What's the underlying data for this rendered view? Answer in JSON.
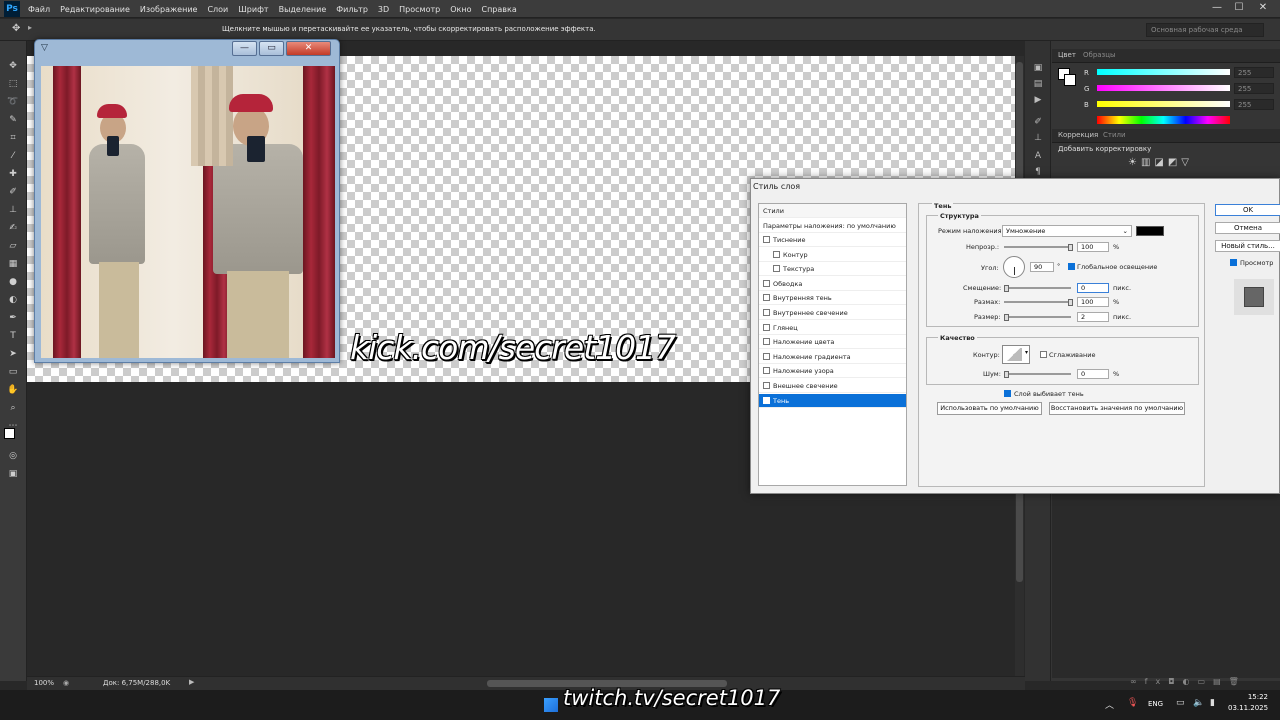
{
  "app": {
    "logo": "Ps"
  },
  "menu": [
    "Файл",
    "Редактирование",
    "Изображение",
    "Слои",
    "Шрифт",
    "Выделение",
    "Фильтр",
    "3D",
    "Просмотр",
    "Окно",
    "Справка"
  ],
  "window_controls": {
    "min": "—",
    "max": "☐",
    "close": "✕"
  },
  "options_bar": {
    "hint": "Щелкните мышью и перетаскивайте ее указатель, чтобы скорректировать расположение эффекта.",
    "workspace": "Основная рабочая среда"
  },
  "overlay": {
    "kick": "kick.com/secret1017",
    "twitch": "twitch.tv/secret1017"
  },
  "photo_window": {
    "btn_min": "—",
    "btn_max": "▭",
    "btn_close": "✕"
  },
  "color_panel": {
    "tabs": [
      "Цвет",
      "Образцы"
    ],
    "channels": [
      {
        "label": "R",
        "value": "255"
      },
      {
        "label": "G",
        "value": "255"
      },
      {
        "label": "B",
        "value": "255"
      }
    ]
  },
  "adjust_panel": {
    "tabs": [
      "Коррекция",
      "Стили"
    ],
    "heading": "Добавить корректировку"
  },
  "dialog": {
    "title": "Стиль слоя",
    "styles_header": "Стили",
    "blend_default": "Параметры наложения: по умолчанию",
    "items": [
      {
        "label": "Тиснение",
        "checked": false,
        "indent": false
      },
      {
        "label": "Контур",
        "checked": false,
        "indent": true
      },
      {
        "label": "Текстура",
        "checked": false,
        "indent": true
      },
      {
        "label": "Обводка",
        "checked": false,
        "indent": false
      },
      {
        "label": "Внутренняя тень",
        "checked": false,
        "indent": false
      },
      {
        "label": "Внутреннее свечение",
        "checked": false,
        "indent": false
      },
      {
        "label": "Глянец",
        "checked": false,
        "indent": false
      },
      {
        "label": "Наложение цвета",
        "checked": false,
        "indent": false
      },
      {
        "label": "Наложение градиента",
        "checked": false,
        "indent": false
      },
      {
        "label": "Наложение узора",
        "checked": false,
        "indent": false
      },
      {
        "label": "Внешнее свечение",
        "checked": false,
        "indent": false
      },
      {
        "label": "Тень",
        "checked": true,
        "indent": false,
        "selected": true
      }
    ],
    "section_title": "Тень",
    "structure": {
      "title": "Структура",
      "blend_mode_label": "Режим наложения:",
      "blend_mode_value": "Умножение",
      "shadow_color": "#000000",
      "opacity_label": "Непрозр.:",
      "opacity_value": "100",
      "opacity_unit": "%",
      "angle_label": "Угол:",
      "angle_value": "90",
      "angle_unit": "°",
      "global_light_label": "Глобальное освещение",
      "global_light_checked": true,
      "distance_label": "Смещение:",
      "distance_value": "0",
      "distance_unit": "пикс.",
      "spread_label": "Размах:",
      "spread_value": "100",
      "spread_unit": "%",
      "size_label": "Размер:",
      "size_value": "2",
      "size_unit": "пикс."
    },
    "quality": {
      "title": "Качество",
      "contour_label": "Контур:",
      "antialias_label": "Сглаживание",
      "noise_label": "Шум:",
      "noise_value": "0",
      "noise_unit": "%"
    },
    "knockout_label": "Слой выбивает тень",
    "btn_default": "Использовать по умолчанию",
    "btn_reset": "Восстановить значения по умолчанию",
    "ok": "OK",
    "cancel": "Отмена",
    "new_style": "Новый стиль...",
    "preview_label": "Просмотр"
  },
  "status": {
    "zoom": "100%",
    "doc": "Док: 6,75M/288,0K"
  },
  "taskbar": {
    "lang": "ENG",
    "time": "15:22",
    "date": "03.11.2025"
  }
}
